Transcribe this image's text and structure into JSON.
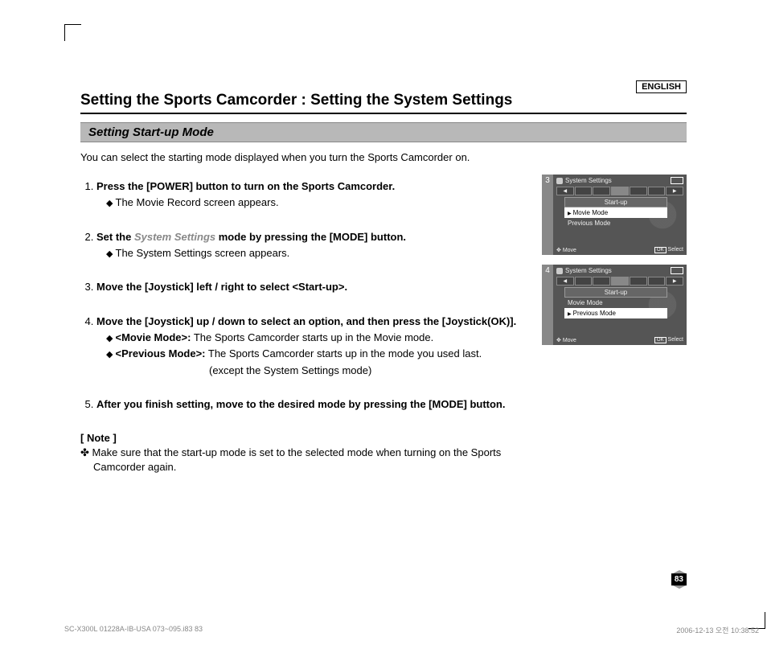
{
  "language": "ENGLISH",
  "title": "Setting the Sports Camcorder : Setting the System Settings",
  "subtitle": "Setting Start-up Mode",
  "intro": "You can select the starting mode displayed when you turn the Sports Camcorder on.",
  "steps": {
    "s1": {
      "head": "Press the [POWER] button to turn on the Sports Camcorder.",
      "b1": "The Movie Record screen appears."
    },
    "s2": {
      "head_a": "Set the ",
      "head_muted": "System Settings",
      "head_b": " mode by pressing the [MODE] button.",
      "b1": "The System Settings screen appears."
    },
    "s3": {
      "head": "Move the [Joystick] left / right to select <Start-up>."
    },
    "s4": {
      "head": "Move the [Joystick] up / down to select an option, and then press the [Joystick(OK)].",
      "b1a": "<Movie Mode>:",
      "b1b": " The Sports Camcorder starts up in the Movie mode.",
      "b2a": "<Previous Mode>:",
      "b2b": " The Sports Camcorder starts up in the mode you used last.",
      "b2c": "(except the System Settings mode)"
    },
    "s5": {
      "head": "After you finish setting, move to the desired mode by pressing the [MODE] button."
    }
  },
  "note": {
    "head": "[ Note ]",
    "bullet": "✤",
    "text": "Make sure that the start-up mode is set to the selected mode when turning on the Sports Camcorder again."
  },
  "figures": {
    "f3": {
      "num": "3",
      "title": "System Settings",
      "tab": "Start-up",
      "opt1": "Movie Mode",
      "opt2": "Previous Mode",
      "move": "Move",
      "ok": "OK",
      "select": "Select",
      "selected": 1
    },
    "f4": {
      "num": "4",
      "title": "System Settings",
      "tab": "Start-up",
      "opt1": "Movie Mode",
      "opt2": "Previous Mode",
      "move": "Move",
      "ok": "OK",
      "select": "Select",
      "selected": 2
    }
  },
  "page_number": "83",
  "footer_left": "SC-X300L 01228A-IB-USA 073~095.i83   83",
  "footer_right": "2006-12-13   오전 10:38:52"
}
